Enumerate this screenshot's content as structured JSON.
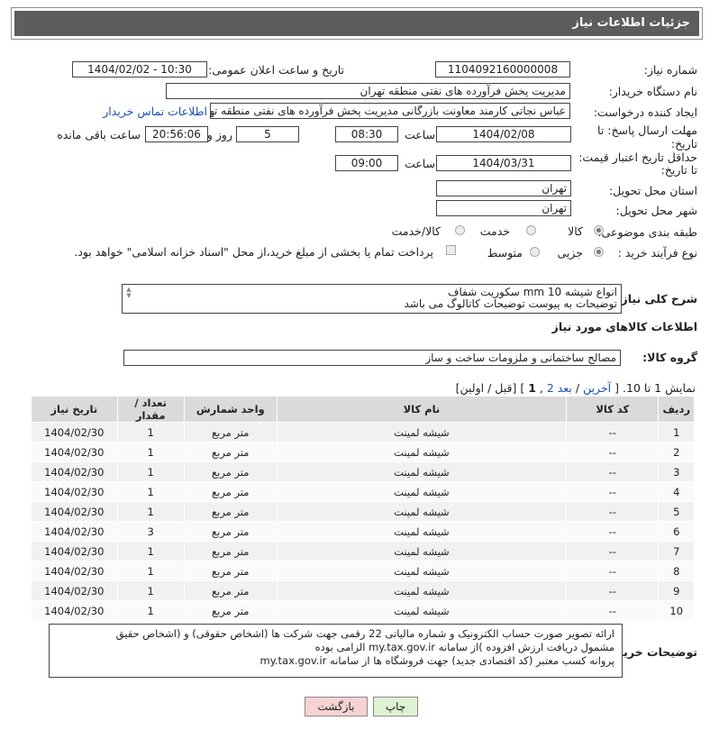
{
  "header": {
    "title": "جزئیات اطلاعات نیاز"
  },
  "form": {
    "need_number": {
      "label": "شماره نیاز:",
      "value": "1104092160000008"
    },
    "announce_datetime": {
      "label": "تاریخ و ساعت اعلان عمومی:",
      "value": "1404/02/02 - 10:30"
    },
    "buyer_org": {
      "label": "نام دستگاه خریدار:",
      "value": "مدیریت پخش فرآورده های نفتی منطقه تهران"
    },
    "creator": {
      "label": "ایجاد کننده درخواست:",
      "value": "عباس نجاتی کارمند معاونت بازرگانی مدیریت پخش فرآورده های نفتی منطقه تهران",
      "contact_link": "اطلاعات تماس خریدار"
    },
    "response_deadline": {
      "label_line1": "مهلت ارسال پاسخ: تا",
      "label_line2": "تاریخ:",
      "date": "1404/02/08",
      "time_label": "ساعت",
      "time": "08:30",
      "days": "5",
      "days_label": "روز و",
      "remaining": "20:56:06",
      "remaining_label": "ساعت باقی مانده"
    },
    "price_validity": {
      "label_line1": "حداقل تاریخ اعتبار قیمت:",
      "label_line2": "تا تاریخ:",
      "date": "1404/03/31",
      "time_label": "ساعت",
      "time": "09:00"
    },
    "delivery_province": {
      "label": "استان محل تحویل:",
      "value": "تهران"
    },
    "delivery_city": {
      "label": "شهر محل تحویل:",
      "value": "تهران"
    },
    "category": {
      "label": "طبقه بندی موضوعی:",
      "options": [
        "کالا",
        "خدمت",
        "کالا/خدمت"
      ],
      "selected": "کالا"
    },
    "process_type": {
      "label": "نوع فرآیند خرید :",
      "options": [
        "جزیی",
        "متوسط"
      ],
      "payment_note": "پرداخت تمام یا بخشی از مبلغ خرید،از محل \"اسناد خزانه اسلامی\" خواهد بود."
    }
  },
  "description": {
    "label": "شرح کلی نیاز:",
    "lines": [
      "انواع شیشه mm 10  سکوریت شفاف",
      "توضیحات به پیوست توضیحات کاتالوگ می باشد"
    ]
  },
  "goods_info": {
    "title": "اطلاعات کالاهای مورد نیاز",
    "group_label": "گروه کالا:",
    "group_value": "مصالح ساختمانی و ملزومات ساخت و ساز"
  },
  "pager": {
    "showing": "نمایش 1 تا 10.",
    "open": "[",
    "last": "آخرین",
    "sep": "/",
    "next": "بعد",
    "page2": "2",
    "comma": ",",
    "page1": "1",
    "close": "]",
    "prev_first": "[قبل / اولین]"
  },
  "table": {
    "headers": [
      "ردیف",
      "کد کالا",
      "نام کالا",
      "واحد شمارش",
      "تعداد / مقدار",
      "تاریخ نیاز"
    ],
    "rows": [
      [
        "1",
        "--",
        "شیشه لمینت",
        "متر مربع",
        "1",
        "1404/02/30"
      ],
      [
        "2",
        "--",
        "شیشه لمینت",
        "متر مربع",
        "1",
        "1404/02/30"
      ],
      [
        "3",
        "--",
        "شیشه لمینت",
        "متر مربع",
        "1",
        "1404/02/30"
      ],
      [
        "4",
        "--",
        "شیشه لمینت",
        "متر مربع",
        "1",
        "1404/02/30"
      ],
      [
        "5",
        "--",
        "شیشه لمینت",
        "متر مربع",
        "1",
        "1404/02/30"
      ],
      [
        "6",
        "--",
        "شیشه لمینت",
        "متر مربع",
        "3",
        "1404/02/30"
      ],
      [
        "7",
        "--",
        "شیشه لمینت",
        "متر مربع",
        "1",
        "1404/02/30"
      ],
      [
        "8",
        "--",
        "شیشه لمینت",
        "متر مربع",
        "1",
        "1404/02/30"
      ],
      [
        "9",
        "--",
        "شیشه لمینت",
        "متر مربع",
        "1",
        "1404/02/30"
      ],
      [
        "10",
        "--",
        "شیشه لمینت",
        "متر مربع",
        "1",
        "1404/02/30"
      ]
    ]
  },
  "buyer_notes": {
    "label": "توضیحات خریدار:",
    "lines": [
      "ارائه  تصویر صورت حساب الکترونیک و شماره مالیاتی 22 رقمی  جهت شرکت ها (اشخاص حقوقی) و (اشخاص حقیق",
      "مشمول دریافت ارزش افزوده )از سامانه my.tax.gov.ir  الزامی بوده",
      "پروانه کسب معتبر (کد اقتصادی جدید) جهت فروشگاه ها از سامانه my.tax.gov.ir"
    ]
  },
  "buttons": {
    "back": "بازگشت",
    "print": "چاپ"
  },
  "colors": {
    "header_bg": "#5d5d5d",
    "back_btn_bg": "#f7d2d2",
    "print_btn_bg": "#ddf2d4",
    "link": "#1a4fb3"
  }
}
